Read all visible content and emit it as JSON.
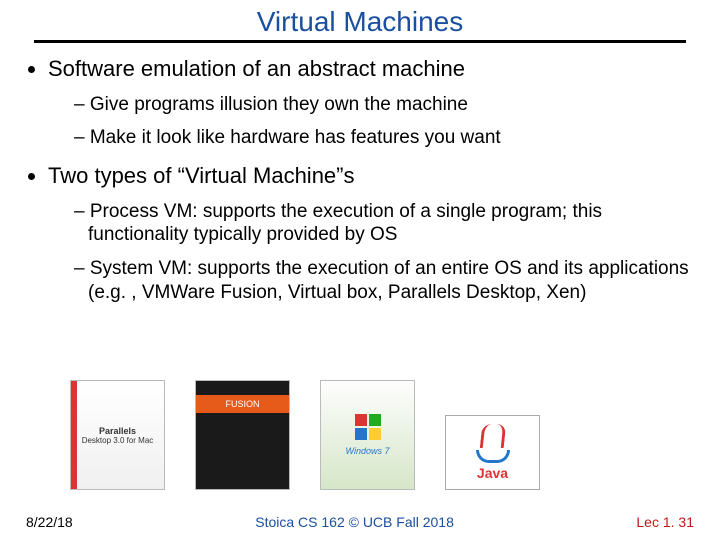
{
  "title": "Virtual Machines",
  "bullets": {
    "b1": "Software emulation of an abstract machine",
    "b1s1": "Give programs illusion they own the machine",
    "b1s2": "Make it look like hardware has features you want",
    "b2": "Two types of “Virtual Machine”s",
    "b2s1": "Process VM: supports the execution of a single program; this functionality typically provided by OS",
    "b2s2": "System VM: supports the execution of an entire OS and its applications (e.g. , VMWare Fusion, Virtual box, Parallels Desktop, Xen)"
  },
  "products": {
    "parallels_line1": "Parallels",
    "parallels_line2": "Desktop 3.0 for Mac",
    "fusion_label": "FUSION",
    "win7_label": "Windows 7",
    "java_label": "Java"
  },
  "footer": {
    "date": "8/22/18",
    "center": "Stoica CS 162 © UCB Fall 2018",
    "lec": "Lec 1. 31"
  }
}
